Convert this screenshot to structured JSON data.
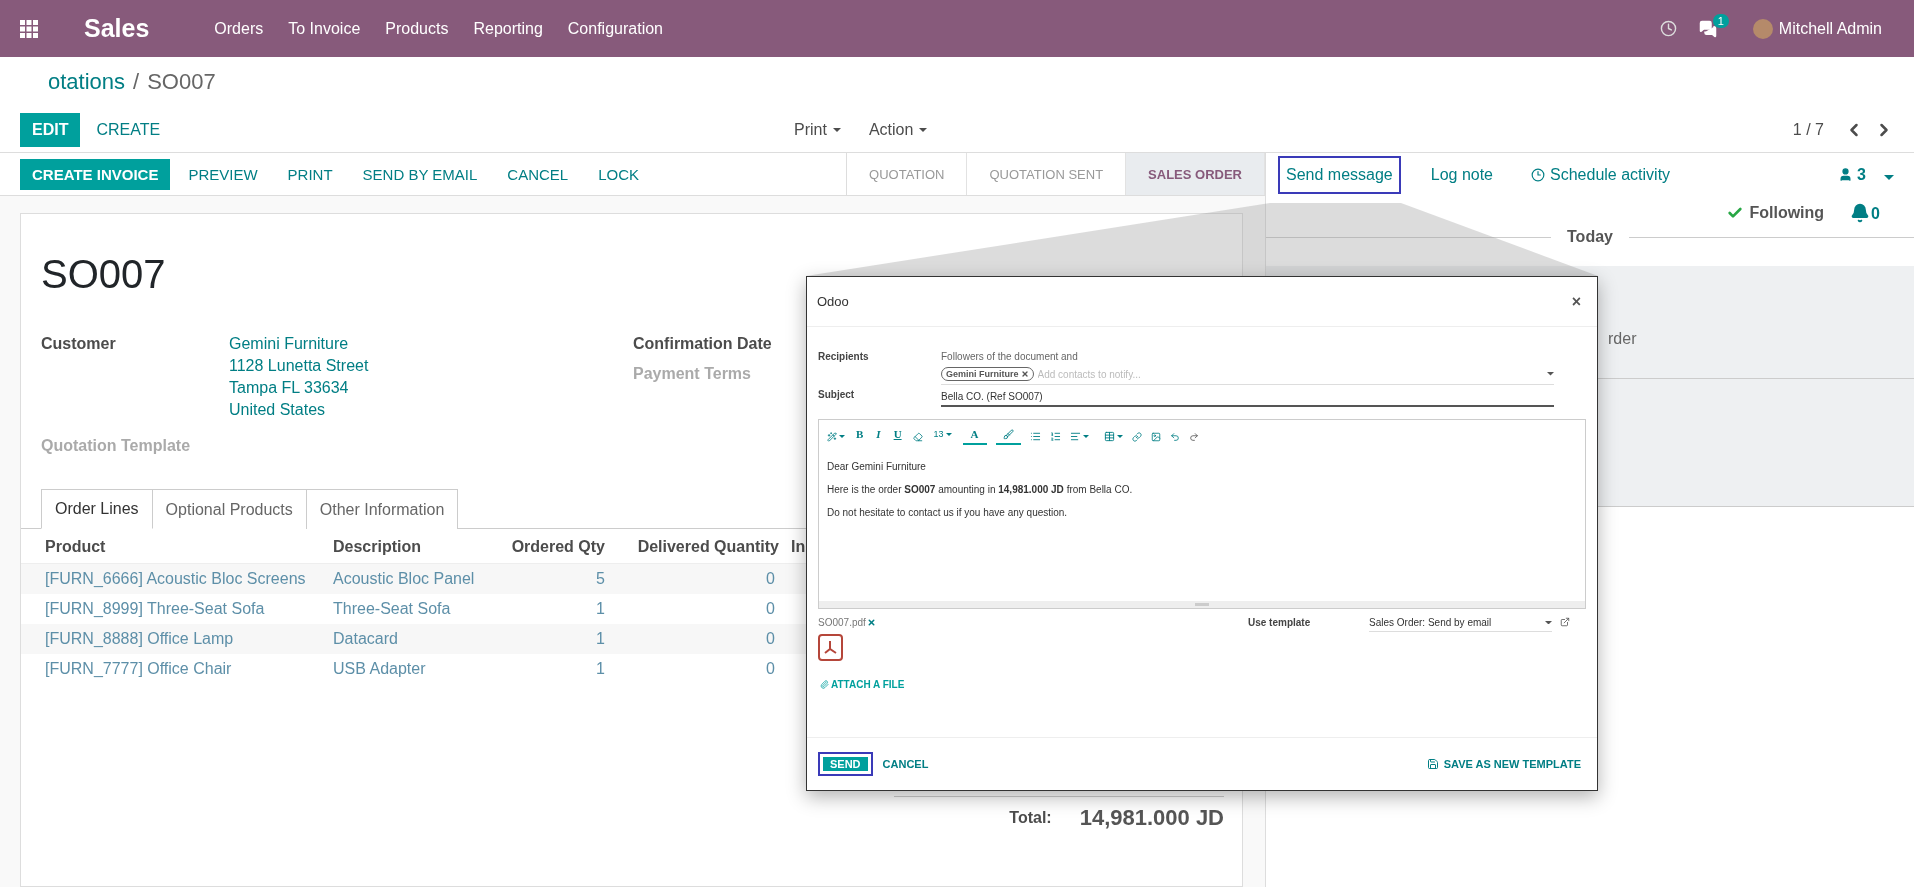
{
  "navbar": {
    "app_title": "Sales",
    "menu": [
      "Orders",
      "To Invoice",
      "Products",
      "Reporting",
      "Configuration"
    ],
    "messages_badge": "1",
    "user": "Mitchell Admin"
  },
  "breadcrumb": {
    "parent": "otations",
    "separator": "/",
    "current": "SO007"
  },
  "control_panel": {
    "buttons": [
      {
        "label": "EDIT",
        "kind": "primary"
      },
      {
        "label": "CREATE",
        "kind": "link"
      }
    ],
    "dropdowns": [
      "Print",
      "Action"
    ],
    "pager": "1 / 7"
  },
  "statusbar": {
    "buttons": [
      {
        "label": "CREATE INVOICE",
        "kind": "primary"
      },
      {
        "label": "PREVIEW",
        "kind": "link"
      },
      {
        "label": "PRINT",
        "kind": "link"
      },
      {
        "label": "SEND BY EMAIL",
        "kind": "link"
      },
      {
        "label": "CANCEL",
        "kind": "link"
      },
      {
        "label": "LOCK",
        "kind": "link"
      }
    ],
    "stages": [
      {
        "label": "QUOTATION",
        "selected": false
      },
      {
        "label": "QUOTATION SENT",
        "selected": false
      },
      {
        "label": "SALES ORDER",
        "selected": true
      }
    ]
  },
  "form": {
    "title": "SO007",
    "left_fields": [
      {
        "label": "Customer",
        "muted": false,
        "lines": [
          "Gemini Furniture",
          "1128 Lunetta Street",
          "Tampa FL 33634",
          "United States"
        ]
      },
      {
        "label": "Quotation Template",
        "muted": true
      }
    ],
    "right_fields": [
      {
        "label": "Confirmation Date",
        "muted": false
      },
      {
        "label": "Payment Terms",
        "muted": true
      }
    ],
    "tabs": [
      {
        "label": "Order Lines",
        "selected": true
      },
      {
        "label": "Optional Products",
        "selected": false
      },
      {
        "label": "Other Information",
        "selected": false
      }
    ],
    "table": {
      "columns": [
        "Product",
        "Description",
        "Ordered Qty",
        "Delivered Quantity",
        "In"
      ],
      "rows": [
        [
          "[FURN_6666] Acoustic Bloc Screens",
          "Acoustic Bloc Panel",
          "5",
          "0"
        ],
        [
          "[FURN_8999] Three-Seat Sofa",
          "Three-Seat Sofa",
          "1",
          "0"
        ],
        [
          "[FURN_8888] Office Lamp",
          "Datacard",
          "1",
          "0"
        ],
        [
          "[FURN_7777] Office Chair",
          "USB Adapter",
          "1",
          "0"
        ]
      ]
    },
    "total": {
      "label": "Total:",
      "value": "14,981.000 JD"
    }
  },
  "chatter": {
    "actions": [
      {
        "label": "Send message",
        "kind": "message",
        "highlighted": true
      },
      {
        "label": "Log note",
        "kind": "note",
        "highlighted": false
      },
      {
        "label": "Schedule activity",
        "kind": "activity",
        "highlighted": false
      }
    ],
    "followers_count": "3",
    "follow_label": "Following",
    "notify_count": "0",
    "date_separator": "Today",
    "message_fragment": "rder"
  },
  "dialog": {
    "title": "Odoo",
    "close": "×",
    "recipients": {
      "label": "Recipients",
      "note": "Followers of the document and",
      "tag": "Gemini Furniture",
      "placeholder": "Add contacts to notify..."
    },
    "subject": {
      "label": "Subject",
      "value": "Bella CO. (Ref SO007)"
    },
    "toolbar": {
      "bold": "B",
      "italic": "I",
      "underline": "U",
      "font_size": "13",
      "font_color": "A"
    },
    "body": [
      "Dear Gemini Furniture",
      "Here is the order **SO007** amounting in **14,981.000 JD** from Bella CO.",
      "Do not hesitate to contact us if you have any question."
    ],
    "attachment": "SO007.pdf",
    "attach_label": "ATTACH A FILE",
    "template": {
      "label": "Use template",
      "value": "Sales Order: Send by email"
    },
    "footer": [
      {
        "label": "SEND",
        "kind": "primary",
        "highlighted": true
      },
      {
        "label": "CANCEL",
        "kind": "link",
        "highlighted": false
      },
      {
        "label": "SAVE AS NEW TEMPLATE",
        "kind": "save",
        "highlighted": false
      }
    ]
  }
}
